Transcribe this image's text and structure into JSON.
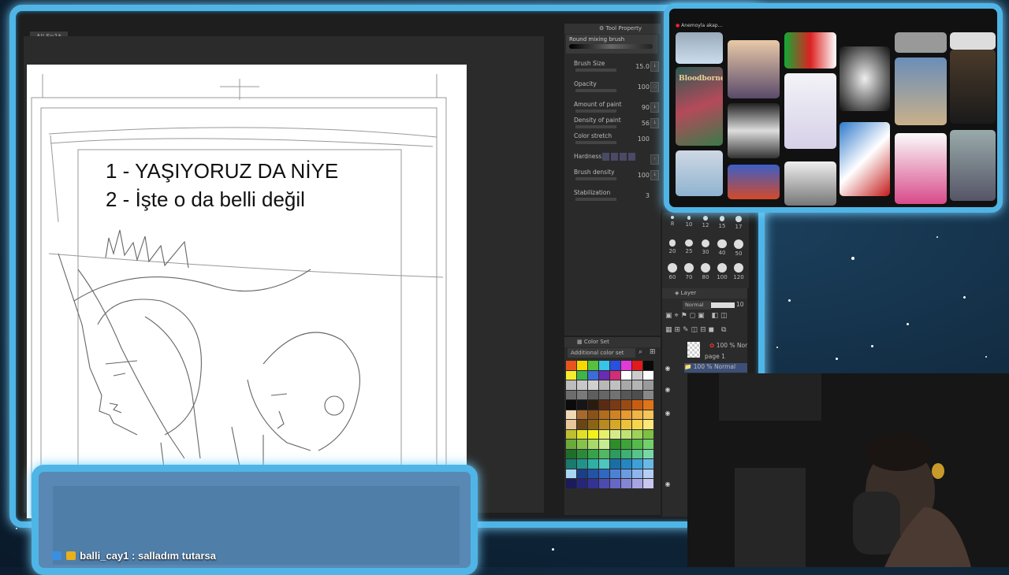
{
  "document_tab": "All Ep1*",
  "canvas": {
    "lines": [
      "1 - YAŞIYORUZ DA NİYE",
      "2 - İşte o da belli değil"
    ]
  },
  "tool_property": {
    "panel_title": "Tool Property",
    "brush_name": "Round mixing brush",
    "props": [
      {
        "label": "Brush Size",
        "value": "15.0"
      },
      {
        "label": "Opacity",
        "value": "100"
      },
      {
        "label": "Amount of paint",
        "value": "90"
      },
      {
        "label": "Density of paint",
        "value": "56"
      },
      {
        "label": "Color stretch",
        "value": "100"
      },
      {
        "label": "Hardness",
        "value": ""
      },
      {
        "label": "Brush density",
        "value": "100"
      },
      {
        "label": "Stabilization",
        "value": "3"
      }
    ]
  },
  "color_set": {
    "panel_title": "Color Set",
    "selected_set": "Additional color set",
    "swatches": [
      "#e8541d",
      "#f5d900",
      "#57c13b",
      "#36c5e8",
      "#2a50e0",
      "#e23ad8",
      "#e21a1a",
      "#0a0a0a",
      "#f5ec2c",
      "#3db548",
      "#3b6cd9",
      "#6a2bb5",
      "#d22d7a",
      "#ffffff",
      "#cccccc",
      "#ffffff",
      "#bdbdbd",
      "#c8c8c8",
      "#d0d0d0",
      "#b8b8b8",
      "#c0c0c0",
      "#a8a8a8",
      "#b4b4b4",
      "#9a9a9a",
      "#6d6d6d",
      "#7a7a7a",
      "#5e5e5e",
      "#666666",
      "#727272",
      "#575757",
      "#4e4e4e",
      "#888888",
      "#0b0b0b",
      "#161616",
      "#2b1a0e",
      "#5a2b12",
      "#7a3a15",
      "#9a4b14",
      "#c85d12",
      "#e07418",
      "#f1d9b5",
      "#a86a2c",
      "#8a5218",
      "#b36b1c",
      "#d08324",
      "#e69a30",
      "#f2b347",
      "#f7c558",
      "#e8c79a",
      "#6b4612",
      "#8c6416",
      "#b88a1f",
      "#d6a829",
      "#ecc23a",
      "#f6d64f",
      "#fbe77a",
      "#bfbf30",
      "#e0e027",
      "#f2f21a",
      "#e8f06b",
      "#d6ea8c",
      "#bfe276",
      "#9fd25b",
      "#7cc143",
      "#6aa93a",
      "#86c34e",
      "#a9d96b",
      "#c6eb92",
      "#2f8c2a",
      "#3ea33a",
      "#56b94e",
      "#73cf6a",
      "#1f6e2a",
      "#2b8a3a",
      "#38a24a",
      "#52b863",
      "#2d9a5e",
      "#3fb072",
      "#58c48a",
      "#79d6a6",
      "#1a7a6e",
      "#22938a",
      "#2fb0a4",
      "#4dc6bc",
      "#1b6ea5",
      "#2486c2",
      "#3ea0d8",
      "#69b9e6",
      "#a8d6f0",
      "#1a3f8a",
      "#2453a6",
      "#2f68c2",
      "#4b82d6",
      "#6b9ce2",
      "#8fb6ec",
      "#b5cff4",
      "#1b1b5a",
      "#262678",
      "#333396",
      "#4b4bb0",
      "#6767c6",
      "#8585d6",
      "#a5a5e4",
      "#c7c7f0"
    ]
  },
  "brush_sizes": [
    "8",
    "10",
    "12",
    "15",
    "17",
    "20",
    "25",
    "30",
    "40",
    "50",
    "60",
    "70",
    "80",
    "100",
    "120"
  ],
  "layers": {
    "panel_title": "Layer",
    "blend_mode": "Normal",
    "opacity_value": "10",
    "rows": [
      {
        "label": "100 % Nor",
        "sub": "page 1"
      },
      {
        "label": "100 % Normal",
        "sub": ""
      }
    ]
  },
  "reference": {
    "header_text": "Anemoyla akap...",
    "thumb_text": "Bloodborne"
  },
  "chat": {
    "username": "balli_cay1",
    "message": ": salladım tutarsa"
  }
}
